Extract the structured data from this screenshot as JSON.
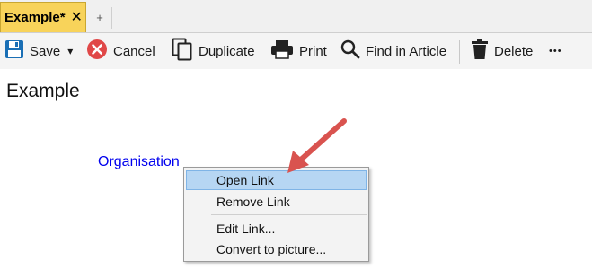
{
  "tabs": [
    {
      "label": "Example*",
      "close_glyph": "✕"
    }
  ],
  "new_tab_glyph": "+",
  "toolbar": {
    "save_label": "Save",
    "save_dropdown_glyph": "▾",
    "cancel_label": "Cancel",
    "duplicate_label": "Duplicate",
    "print_label": "Print",
    "find_label": "Find in Article",
    "delete_label": "Delete",
    "more_glyph": "•••",
    "colors": {
      "save": "#1a6fb5",
      "cancel": "#e04848",
      "text": "#1a1a1a"
    }
  },
  "document": {
    "title": "Example",
    "link_text": "Organisation",
    "link_color": "#0000ee"
  },
  "context_menu": {
    "items": [
      {
        "label": "Open Link",
        "highlighted": true
      },
      {
        "label": "Remove Link",
        "highlighted": false
      },
      {
        "label": "Edit Link...",
        "highlighted": false
      },
      {
        "label": "Convert to picture...",
        "highlighted": false
      }
    ],
    "highlight_color": "#b6d6f3"
  },
  "annotation": {
    "arrow_color": "#d9534f",
    "points_to": "Open Link"
  }
}
